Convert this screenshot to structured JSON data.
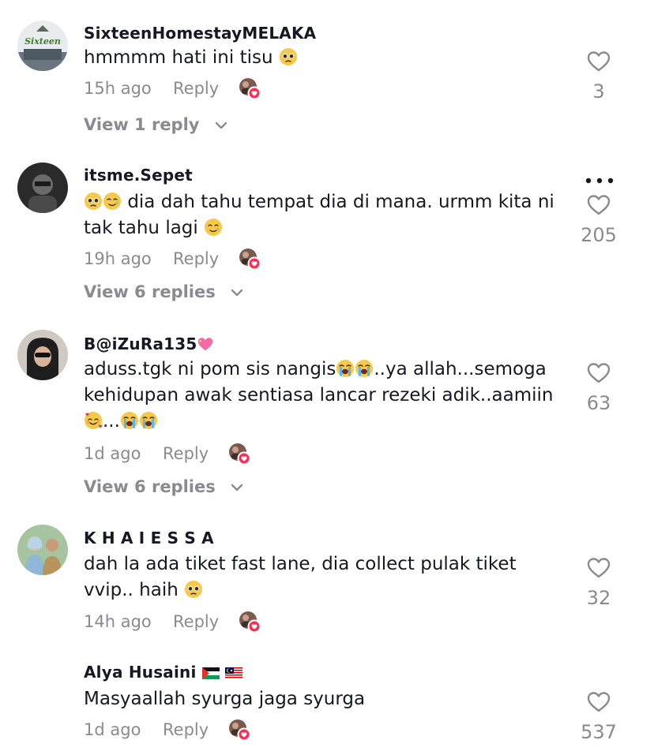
{
  "comments": [
    {
      "username": "SixteenHomestayMELAKA",
      "text": "hmmmm hati ini tisu",
      "time": "15h ago",
      "reply_label": "Reply",
      "likes": "3",
      "view_replies": "View 1 reply"
    },
    {
      "username": "itsme.Sepet",
      "text_a": "dia dah tahu tempat dia di mana. urmm kita ni",
      "text_b": "tak tahu lagi",
      "time": "19h ago",
      "reply_label": "Reply",
      "likes": "205",
      "view_replies": "View 6 replies"
    },
    {
      "username": "B@iZuRa135",
      "text_a": "aduss.tgk ni pom sis nangis",
      "text_b": "..ya allah...semoga",
      "text_c": "kehidupan awak sentiasa lancar rezeki adik..aamiin",
      "text_d": "...",
      "time": "1d ago",
      "reply_label": "Reply",
      "likes": "63",
      "view_replies": "View 6 replies"
    },
    {
      "username": "K H A I E S S A",
      "text_a": "dah la ada tiket fast lane, dia collect pulak tiket",
      "text_b": "vvip.. haih",
      "time": "14h ago",
      "reply_label": "Reply",
      "likes": "32"
    },
    {
      "username": "Alya Husaini",
      "text": "Masyaallah syurga jaga syurga",
      "time": "1d ago",
      "reply_label": "Reply",
      "likes": "537"
    }
  ],
  "icons": {
    "heart": "heart-outline-icon",
    "more": "more-options-icon",
    "chevron": "chevron-down-icon",
    "creator_liked": "creator-liked-icon",
    "pleading_emoji": "pleading-face-emoji",
    "tear_emoji": "smiling-tear-emoji",
    "crying_emoji": "loudly-crying-emoji",
    "hearts_emoji": "smiling-hearts-emoji",
    "heart_emoji": "sparkling-heart-emoji",
    "flag_ps": "palestine-flag-icon",
    "flag_my": "malaysia-flag-icon"
  },
  "colors": {
    "text": "#161823",
    "muted": "#8a8b91",
    "like_badge": "#fe2c55"
  }
}
